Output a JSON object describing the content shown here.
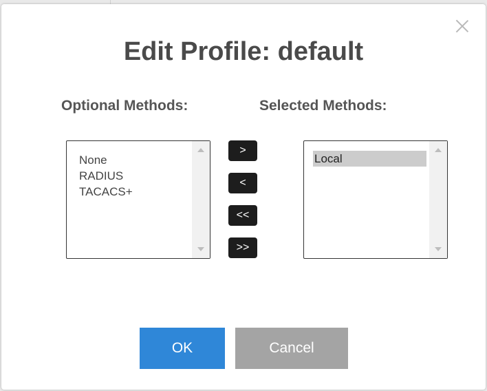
{
  "dialog": {
    "title": "Edit Profile: default",
    "close_icon": "close-icon"
  },
  "optional": {
    "label": "Optional Methods:",
    "items": [
      "None",
      "RADIUS",
      "TACACS+"
    ]
  },
  "selected": {
    "label": "Selected Methods:",
    "items": [
      "Local"
    ],
    "highlighted": "Local"
  },
  "move_buttons": {
    "add": ">",
    "remove": "<",
    "remove_all": "<<",
    "add_all": ">>"
  },
  "footer": {
    "ok_label": "OK",
    "cancel_label": "Cancel"
  },
  "colors": {
    "primary": "#2f87d8",
    "cancel": "#a4a4a4",
    "move_button": "#1d1d1d",
    "selected_item": "#cccccc"
  }
}
